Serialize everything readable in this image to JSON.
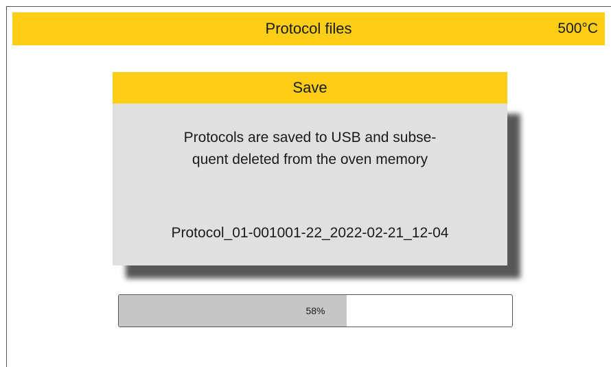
{
  "header": {
    "title": "Protocol files",
    "temperature": "500°C"
  },
  "dialog": {
    "title": "Save",
    "message_line1": "Protocols are saved to USB and subse-",
    "message_line2": "quent deleted from the oven memory",
    "filename": "Protocol_01-001001-22_2022-02-21_12-04"
  },
  "progress": {
    "value": 58,
    "label": "58%"
  },
  "colors": {
    "accent": "#fdcd17",
    "dialog_background": "#e0e0e0",
    "progress_fill": "#c6c6c6"
  }
}
